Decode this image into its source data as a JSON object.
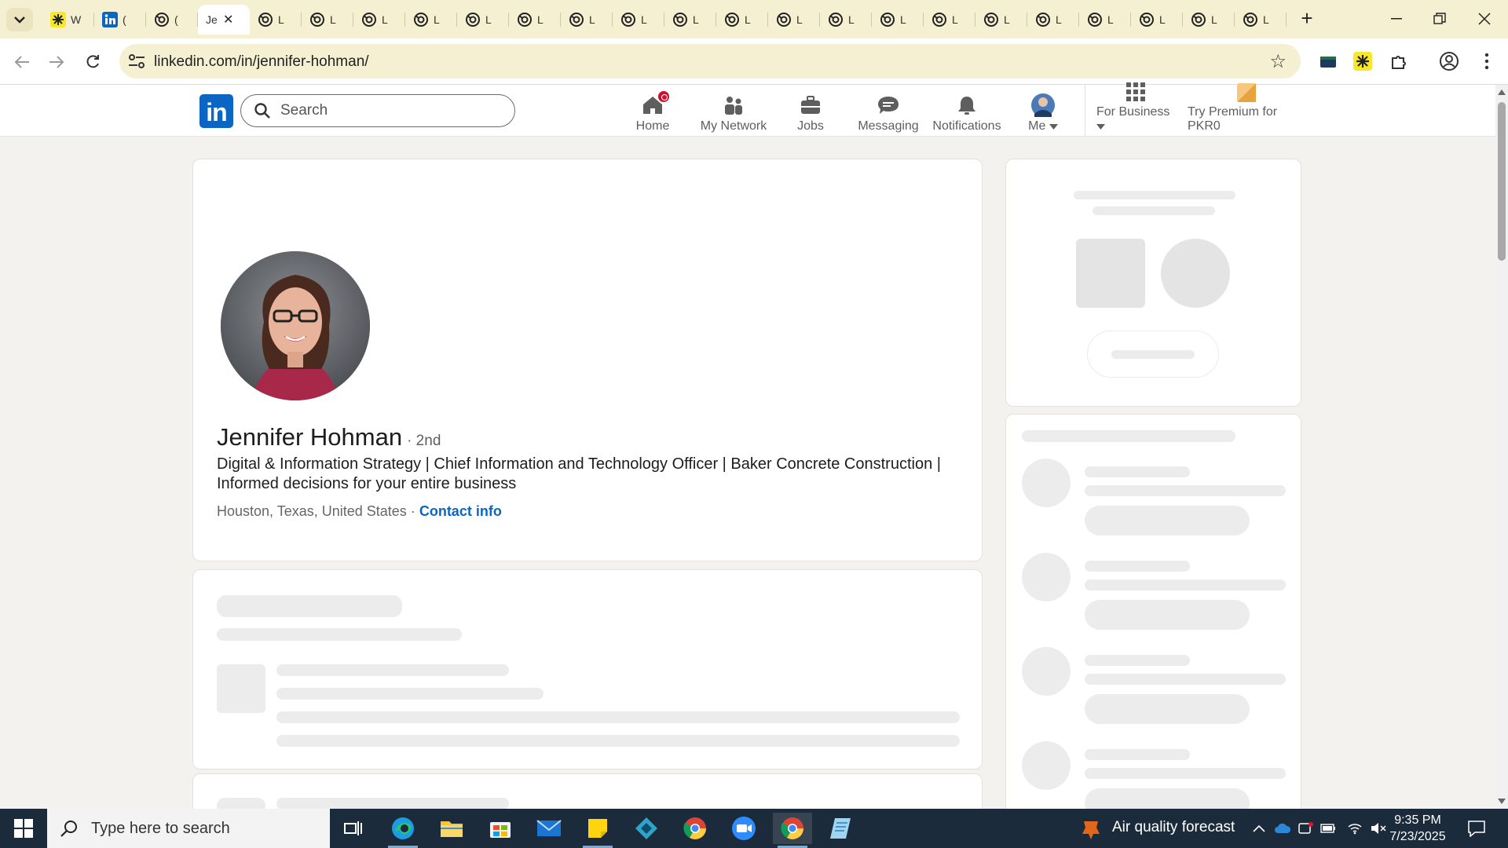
{
  "browser": {
    "tabs": [
      {
        "favicon": "asterisk-yellow-icon",
        "title": "W"
      },
      {
        "favicon": "linkedin-icon",
        "title": "("
      },
      {
        "favicon": "circle-arrows-icon",
        "title": "("
      },
      {
        "favicon": "",
        "title": "Je",
        "active": true
      },
      {
        "favicon": "circle-arrows-icon",
        "title": "L"
      },
      {
        "favicon": "circle-arrows-icon",
        "title": "L"
      },
      {
        "favicon": "circle-arrows-icon",
        "title": "L"
      },
      {
        "favicon": "circle-arrows-icon",
        "title": "L"
      },
      {
        "favicon": "circle-arrows-icon",
        "title": "L"
      },
      {
        "favicon": "circle-arrows-icon",
        "title": "L"
      },
      {
        "favicon": "circle-arrows-icon",
        "title": "L"
      },
      {
        "favicon": "circle-arrows-icon",
        "title": "L"
      },
      {
        "favicon": "circle-arrows-icon",
        "title": "L"
      },
      {
        "favicon": "circle-arrows-icon",
        "title": "L"
      },
      {
        "favicon": "circle-arrows-icon",
        "title": "L"
      },
      {
        "favicon": "circle-arrows-icon",
        "title": "L"
      },
      {
        "favicon": "circle-arrows-icon",
        "title": "L"
      },
      {
        "favicon": "circle-arrows-icon",
        "title": "L"
      },
      {
        "favicon": "circle-arrows-icon",
        "title": "L"
      },
      {
        "favicon": "circle-arrows-icon",
        "title": "L"
      },
      {
        "favicon": "circle-arrows-icon",
        "title": "L"
      },
      {
        "favicon": "circle-arrows-icon",
        "title": "L"
      },
      {
        "favicon": "circle-arrows-icon",
        "title": "L"
      },
      {
        "favicon": "circle-arrows-icon",
        "title": "L"
      }
    ],
    "url": "linkedin.com/in/jennifer-hohman/",
    "accent": "#f5f0d2"
  },
  "linkedin": {
    "search_placeholder": "Search",
    "nav": [
      {
        "label": "Home",
        "icon": "home-icon",
        "badge": true
      },
      {
        "label": "My Network",
        "icon": "network-icon"
      },
      {
        "label": "Jobs",
        "icon": "briefcase-icon"
      },
      {
        "label": "Messaging",
        "icon": "chat-icon"
      },
      {
        "label": "Notifications",
        "icon": "bell-icon"
      },
      {
        "label": "Me",
        "icon": "avatar-icon"
      },
      {
        "label": "For Business",
        "icon": "grid-icon"
      },
      {
        "label": "Try Premium for PKR0",
        "icon": "premium-icon"
      }
    ],
    "brand_color": "#0a66c2"
  },
  "profile": {
    "name": "Jennifer Hohman",
    "degree": "· 2nd",
    "headline": "Digital & Information Strategy | Chief Information and Technology Officer | Baker Concrete Construction | Informed decisions for your entire business",
    "location": "Houston, Texas, United States ·",
    "contact": "Contact info"
  },
  "taskbar": {
    "search_placeholder": "Type here to search",
    "weather": "Air quality forecast",
    "time": "9:35 PM",
    "date": "7/23/2025"
  }
}
